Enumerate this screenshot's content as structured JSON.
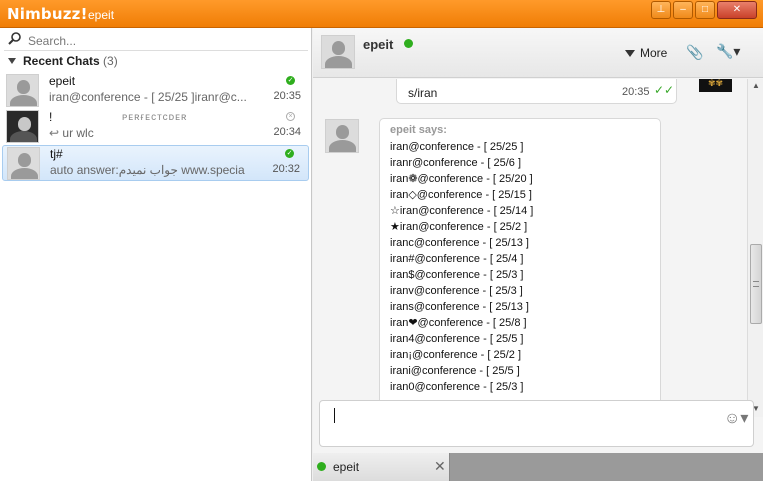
{
  "titlebar": {
    "app": "Nimbuzz!",
    "user": "epeit"
  },
  "window_buttons": [
    "pin",
    "minimize",
    "restore",
    "close"
  ],
  "search": {
    "placeholder": "Search..."
  },
  "recent": {
    "label": "Recent Chats",
    "count": "(3)"
  },
  "chats": [
    {
      "name": "epeit",
      "preview": "iran@conference - [ 25/25 ]iranr@c...",
      "time": "20:35",
      "status": "online"
    },
    {
      "name": "!",
      "status_text": "ᴘᴇʀғᴇᴄᴛᴄᴅᴇʀ",
      "preview": "ur wlc",
      "time": "20:34",
      "status": "offline"
    },
    {
      "name": "tj#",
      "preview": "auto answer:جواب نميدم www.special-...",
      "time": "20:32",
      "status": "online"
    }
  ],
  "conversation": {
    "contact": "epeit",
    "more_label": "More",
    "prev_message": {
      "text": "s/iran",
      "time": "20:35"
    },
    "thumb_text": "✾✾",
    "says": "epeit says:",
    "lines": [
      "iran@conference - [ 25/25 ]",
      "iranr@conference - [ 25/6 ]",
      "iran❁@conference - [ 25/20 ]",
      "iran◇@conference - [ 25/15 ]",
      "☆iran@conference - [ 25/14 ]",
      "★iran@conference - [ 25/2 ]",
      "iranc@conference - [ 25/13 ]",
      "iran#@conference - [ 25/4 ]",
      "iran$@conference - [ 25/3 ]",
      "iranv@conference - [ 25/3 ]",
      "irans@conference - [ 25/13 ]",
      "iran❤@conference - [ 25/8 ]",
      "iran4@conference - [ 25/5 ]",
      "iran¡@conference - [ 25/2 ]",
      "irani@conference - [ 25/5 ]",
      "iran0@conference - [ 25/3 ]"
    ]
  },
  "tab": {
    "name": "epeit"
  }
}
